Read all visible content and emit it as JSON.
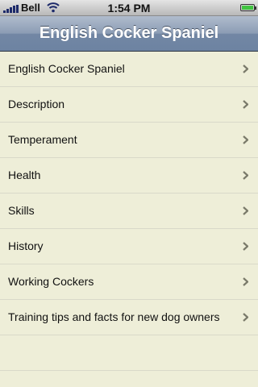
{
  "status_bar": {
    "carrier": "Bell",
    "time": "1:54 PM",
    "icons": [
      "signal-icon",
      "wifi-icon",
      "battery-icon"
    ]
  },
  "nav": {
    "title": "English Cocker Spaniel"
  },
  "list": {
    "items": [
      {
        "label": "English Cocker Spaniel"
      },
      {
        "label": "Description"
      },
      {
        "label": "Temperament"
      },
      {
        "label": "Health"
      },
      {
        "label": "Skills"
      },
      {
        "label": "History"
      },
      {
        "label": "Working Cockers"
      },
      {
        "label": "Training tips and facts for new dog owners"
      }
    ],
    "disclosure_icon": "chevron-right-icon"
  },
  "colors": {
    "nav_bar": "#7a8fab",
    "list_background": "#eeeed8",
    "separator": "#d9d9c9",
    "chevron": "#7a7a6a"
  }
}
